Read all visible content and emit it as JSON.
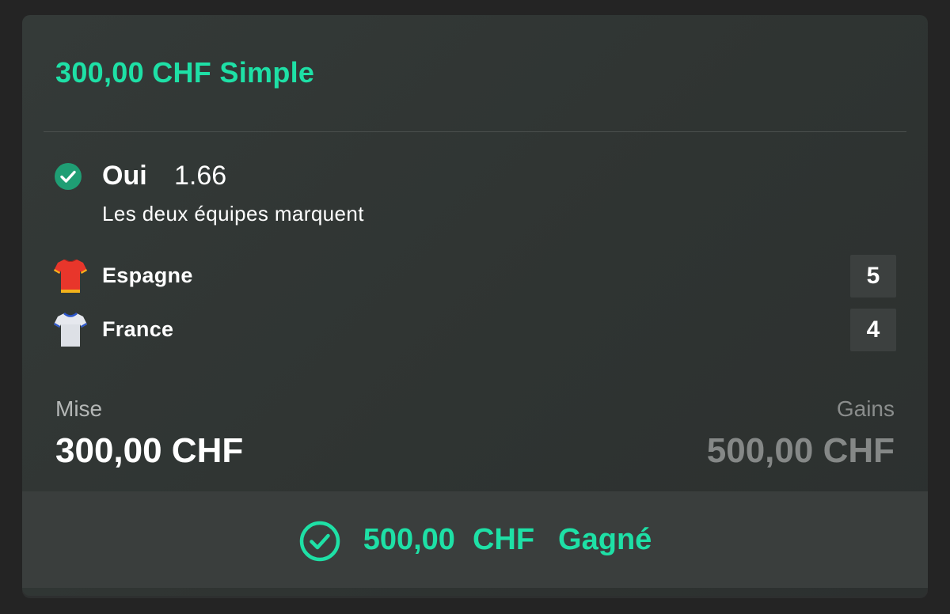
{
  "bet": {
    "title": "300,00 CHF Simple",
    "selection": {
      "name": "Oui",
      "odds": "1.66",
      "market": "Les deux équipes marquent",
      "status_icon": "check-circle-filled-icon"
    },
    "teams": [
      {
        "name": "Espagne",
        "score": "5",
        "jersey_icon": "jersey-red-icon",
        "jersey_color": "#e8362b"
      },
      {
        "name": "France",
        "score": "4",
        "jersey_icon": "jersey-white-icon",
        "jersey_color": "#e6e8ee"
      }
    ],
    "stake": {
      "label": "Mise",
      "value": "300,00 CHF"
    },
    "gains": {
      "label": "Gains",
      "value": "500,00 CHF"
    },
    "result": {
      "amount": "500,00",
      "currency": "CHF",
      "status": "Gagné",
      "icon": "check-circle-outline-icon"
    }
  },
  "colors": {
    "accent": "#1ee0a6",
    "card_background": "#313634",
    "footer_background": "#3a3e3d",
    "win_check": "#1f9e74"
  }
}
